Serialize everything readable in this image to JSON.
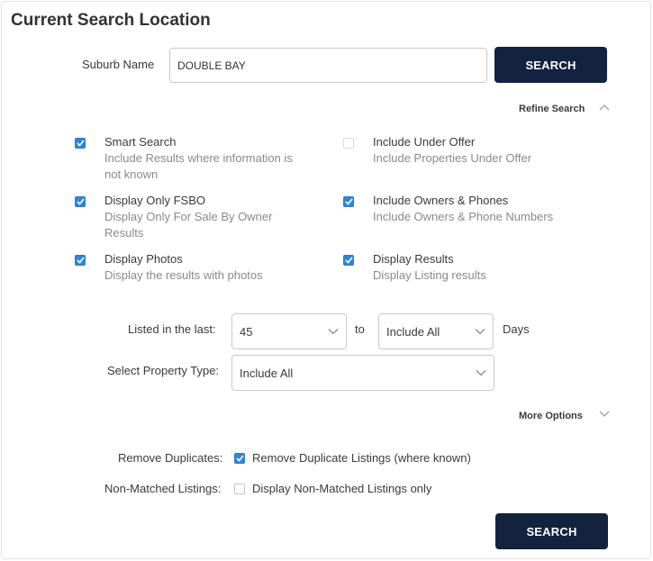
{
  "page_title": "Current Search Location",
  "suburb": {
    "label": "Suburb Name",
    "value": "DOUBLE BAY"
  },
  "search_button_label": "SEARCH",
  "refine_search_label": "Refine Search",
  "options": [
    {
      "title": "Smart Search",
      "desc": "Include Results where information is not known",
      "checked": true
    },
    {
      "title": "Include Under Offer",
      "desc": "Include Properties Under Offer",
      "checked": false
    },
    {
      "title": "Display Only FSBO",
      "desc": "Display Only For Sale By Owner Results",
      "checked": true
    },
    {
      "title": "Include Owners & Phones",
      "desc": "Include Owners & Phone Numbers",
      "checked": true
    },
    {
      "title": "Display Photos",
      "desc": "Display the results with photos",
      "checked": true
    },
    {
      "title": "Display Results",
      "desc": "Display Listing results",
      "checked": true
    }
  ],
  "listed": {
    "label": "Listed in the last:",
    "from_value": "45",
    "to_label": "to",
    "to_value": "Include All",
    "unit_label": "Days"
  },
  "property_type": {
    "label": "Select Property Type:",
    "value": "Include All"
  },
  "more_options_label": "More Options",
  "remove_duplicates": {
    "label": "Remove Duplicates:",
    "option": "Remove Duplicate Listings (where known)",
    "checked": true
  },
  "non_matched": {
    "label": "Non-Matched Listings:",
    "option": "Display Non-Matched Listings only",
    "checked": false
  },
  "colors": {
    "button_bg": "#13223f",
    "checkbox_checked": "#2f86d8",
    "description_text": "#8a8a8a"
  },
  "icons": {
    "expanded": "chevron-up-icon",
    "collapsed": "chevron-down-icon",
    "select": "chevron-down-icon",
    "check": "check-icon"
  }
}
